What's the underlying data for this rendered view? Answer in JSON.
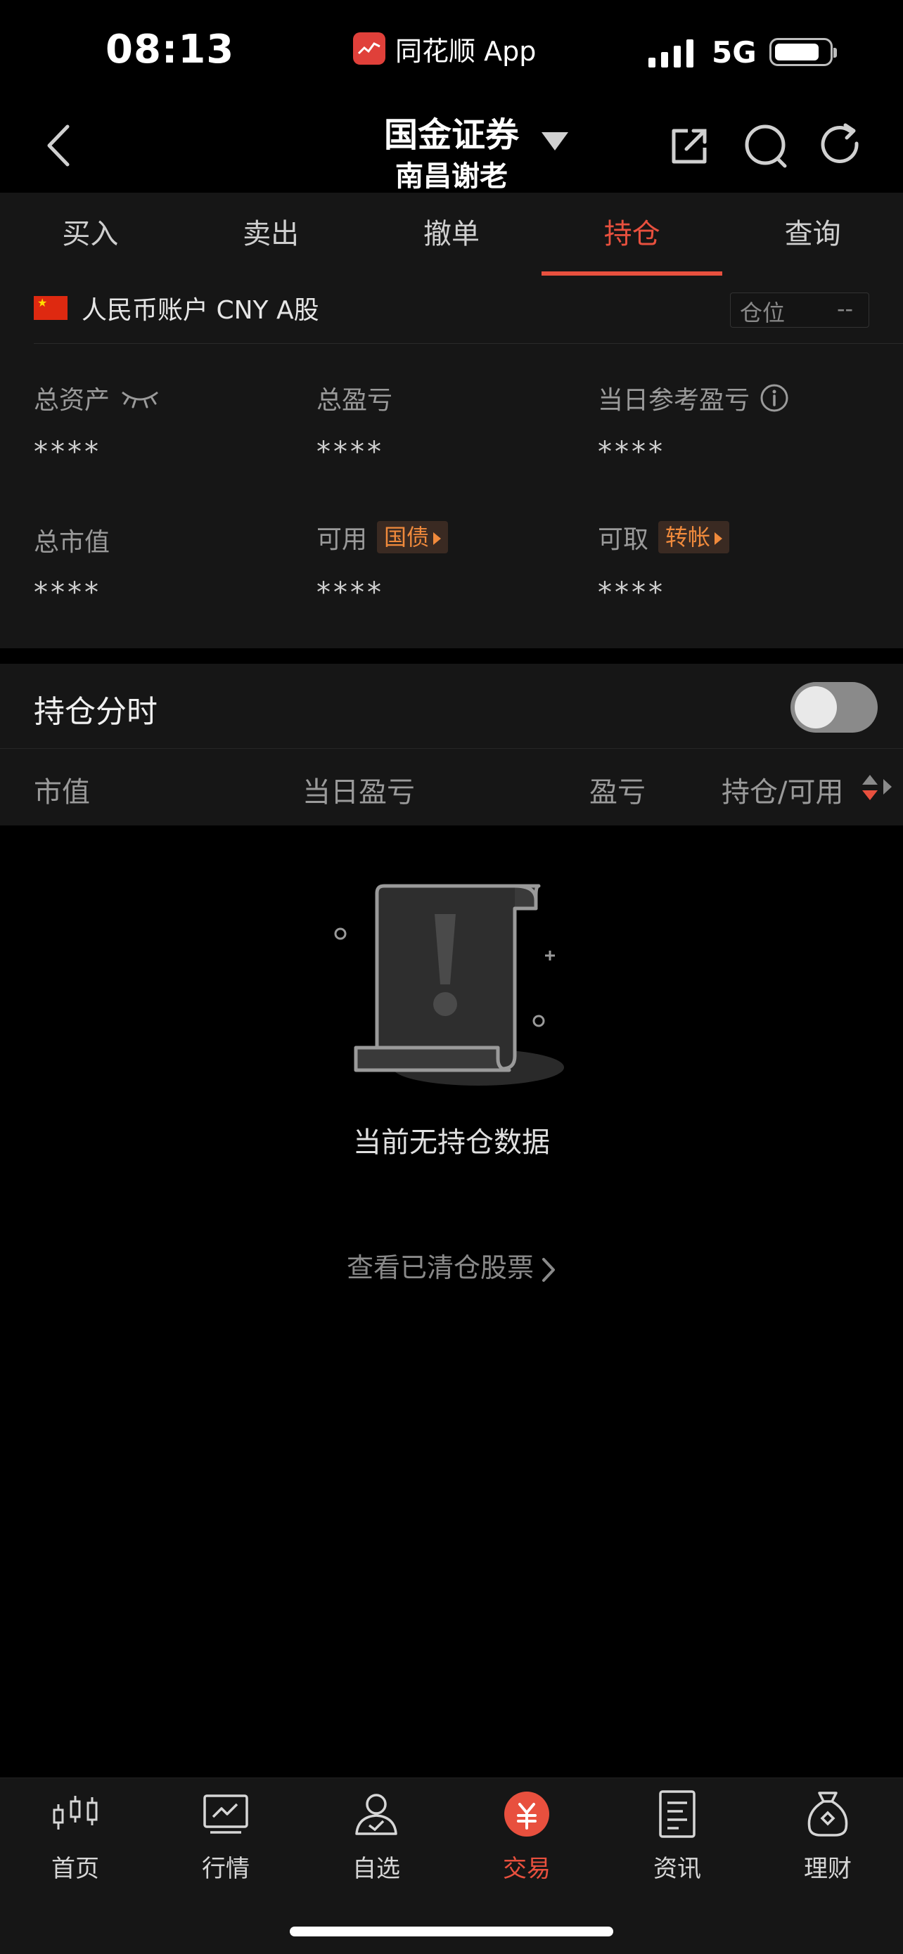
{
  "status_bar": {
    "time": "08:13",
    "app_name": "同花顺 App",
    "network": "5G"
  },
  "header": {
    "title": "国金证券",
    "subtitle": "南昌谢老"
  },
  "tabs": [
    {
      "label": "买入"
    },
    {
      "label": "卖出"
    },
    {
      "label": "撤单"
    },
    {
      "label": "持仓"
    },
    {
      "label": "查询"
    }
  ],
  "account": {
    "label": "人民币账户 CNY A股",
    "position_label": "仓位",
    "position_value": "--"
  },
  "metrics": {
    "total_assets": {
      "label": "总资产",
      "value": "****"
    },
    "total_pnl": {
      "label": "总盈亏",
      "value": "****"
    },
    "daily_pnl": {
      "label": "当日参考盈亏",
      "value": "****"
    },
    "market_value": {
      "label": "总市值",
      "value": "****"
    },
    "available": {
      "label": "可用",
      "value": "****",
      "badge": "国债"
    },
    "withdrawable": {
      "label": "可取",
      "value": "****",
      "badge": "转帐"
    }
  },
  "holdings": {
    "title": "持仓分时",
    "toggle_on": false,
    "columns": [
      "市值",
      "当日盈亏",
      "盈亏",
      "持仓/可用"
    ],
    "empty_text": "当前无持仓数据",
    "cleared_link": "查看已清仓股票"
  },
  "bottom_nav": [
    {
      "label": "首页",
      "icon": "candlestick-icon"
    },
    {
      "label": "行情",
      "icon": "chart-icon"
    },
    {
      "label": "自选",
      "icon": "user-icon"
    },
    {
      "label": "交易",
      "icon": "yuan-icon"
    },
    {
      "label": "资讯",
      "icon": "document-icon"
    },
    {
      "label": "理财",
      "icon": "money-bag-icon"
    }
  ],
  "colors": {
    "accent": "#e8503e",
    "badge_text": "#f08a3c",
    "panel": "#161616",
    "background": "#000000"
  }
}
